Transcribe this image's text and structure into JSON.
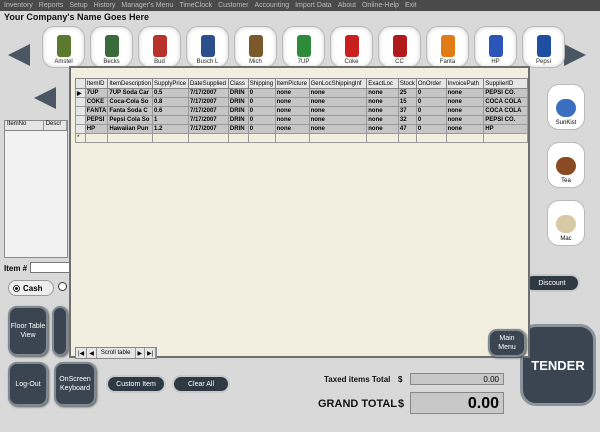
{
  "menu": [
    "Inventory",
    "Reports",
    "Setup",
    "History",
    "Manager's Menu",
    "TimeClock",
    "Customer",
    "Accounting",
    "Import Data",
    "About",
    "Online-Help",
    "Exit"
  ],
  "company_name": "Your Company's Name Goes Here",
  "products_top": [
    {
      "label": "Amstel",
      "color": "#5b7a2f"
    },
    {
      "label": "Becks",
      "color": "#3a6b3a"
    },
    {
      "label": "Bud",
      "color": "#b8322c"
    },
    {
      "label": "Busch L",
      "color": "#2a4f8a"
    },
    {
      "label": "Mich",
      "color": "#7a5a2b"
    },
    {
      "label": "7UP",
      "color": "#2e8b3a"
    },
    {
      "label": "Coke",
      "color": "#c8201e"
    },
    {
      "label": "CC",
      "color": "#b01a1a"
    },
    {
      "label": "Fanta",
      "color": "#e07b16"
    },
    {
      "label": "HP",
      "color": "#2b55b8"
    },
    {
      "label": "Pepsi",
      "color": "#1f4fa0"
    }
  ],
  "products_side": [
    {
      "label": "SunKist",
      "color": "#3a6fc0"
    },
    {
      "label": "Tea",
      "color": "#8a4a22"
    },
    {
      "label": "Mac",
      "color": "#d8c9a5"
    }
  ],
  "left_list_headers": [
    "ItemNo",
    "Descr"
  ],
  "item_label": "Item #",
  "cash_label": "Cash",
  "buttons": {
    "floor_table_view": "Floor Table View",
    "log_out": "Log-Out",
    "onscreen_keyboard": "OnScreen Keyboard",
    "custom_item": "Custom Item",
    "clear_all": "Clear All",
    "discount": "Discount",
    "main_menu": "Main Menu",
    "tender": "TENDER"
  },
  "totals": {
    "taxed_label": "Taxed items Total",
    "taxed_currency": "$",
    "taxed_value": "0.00",
    "grand_label": "GRAND TOTAL",
    "grand_currency": "$",
    "grand_value": "0.00"
  },
  "grid": {
    "headers": [
      "ItemID",
      "ItemDescription",
      "SupplyPrice",
      "DateSupplied",
      "Class",
      "Shipping",
      "ItemPicture",
      "GenLocShippingInf",
      "ExactLoc",
      "Stock",
      "OnOrder",
      "InvoicePath",
      "SupplierID"
    ],
    "rows": [
      [
        "7UP",
        "7UP Soda Car",
        "0.5",
        "7/17/2007",
        "DRIN",
        "0",
        "none",
        "none",
        "none",
        "25",
        "0",
        "none",
        "PEPSI CO."
      ],
      [
        "COKE",
        "Coca-Cola So",
        "0.8",
        "7/17/2007",
        "DRIN",
        "0",
        "none",
        "none",
        "none",
        "15",
        "0",
        "none",
        "COCA COLA"
      ],
      [
        "FANTA",
        "Fanta Soda C",
        "0.6",
        "7/17/2007",
        "DRIN",
        "0",
        "none",
        "none",
        "none",
        "37",
        "0",
        "none",
        "COCA COLA"
      ],
      [
        "PEPSI",
        "Pepsi Cola So",
        "1",
        "7/17/2007",
        "DRIN",
        "0",
        "none",
        "none",
        "none",
        "32",
        "0",
        "none",
        "PEPSI CO."
      ],
      [
        "HP",
        "Hawaiian Pun",
        "1.2",
        "7/17/2007",
        "DRIN",
        "0",
        "none",
        "none",
        "none",
        "47",
        "0",
        "none",
        "HP"
      ]
    ],
    "selected_marker": "▶",
    "new_row_marker": "*",
    "nav_caption": "Scroll table"
  }
}
